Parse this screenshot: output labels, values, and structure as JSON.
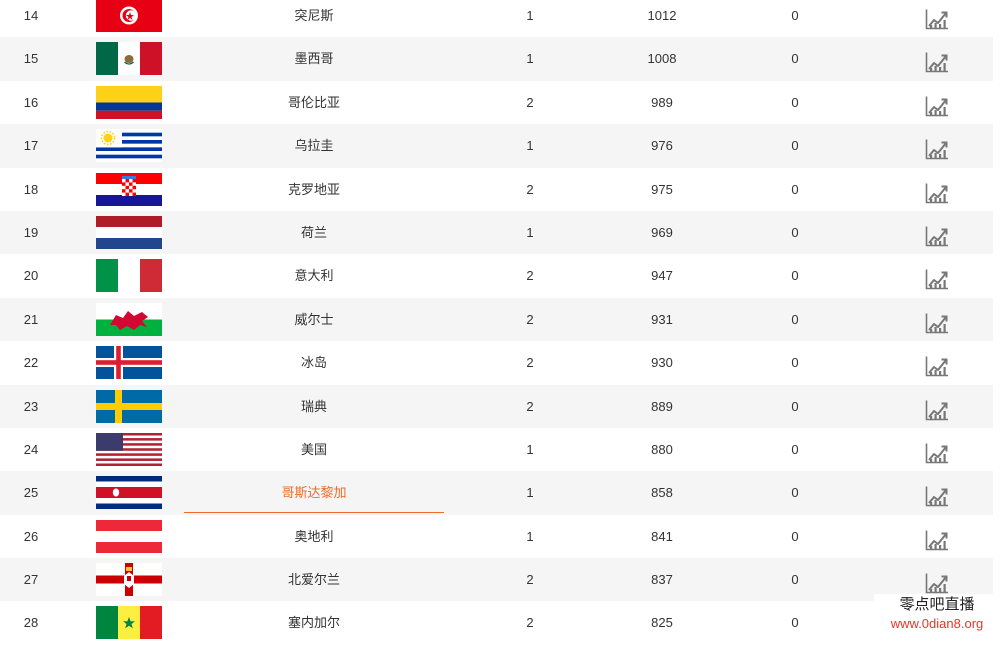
{
  "rows": [
    {
      "rank": "14",
      "country": "突尼斯",
      "played": "1",
      "points": "1012",
      "change": "0",
      "flag": "tunisia-flag"
    },
    {
      "rank": "15",
      "country": "墨西哥",
      "played": "1",
      "points": "1008",
      "change": "0",
      "flag": "mexico-flag"
    },
    {
      "rank": "16",
      "country": "哥伦比亚",
      "played": "2",
      "points": "989",
      "change": "0",
      "flag": "colombia-flag"
    },
    {
      "rank": "17",
      "country": "乌拉圭",
      "played": "1",
      "points": "976",
      "change": "0",
      "flag": "uruguay-flag"
    },
    {
      "rank": "18",
      "country": "克罗地亚",
      "played": "2",
      "points": "975",
      "change": "0",
      "flag": "croatia-flag"
    },
    {
      "rank": "19",
      "country": "荷兰",
      "played": "1",
      "points": "969",
      "change": "0",
      "flag": "netherlands-flag"
    },
    {
      "rank": "20",
      "country": "意大利",
      "played": "2",
      "points": "947",
      "change": "0",
      "flag": "italy-flag"
    },
    {
      "rank": "21",
      "country": "威尔士",
      "played": "2",
      "points": "931",
      "change": "0",
      "flag": "wales-flag"
    },
    {
      "rank": "22",
      "country": "冰岛",
      "played": "2",
      "points": "930",
      "change": "0",
      "flag": "iceland-flag"
    },
    {
      "rank": "23",
      "country": "瑞典",
      "played": "2",
      "points": "889",
      "change": "0",
      "flag": "sweden-flag"
    },
    {
      "rank": "24",
      "country": "美国",
      "played": "1",
      "points": "880",
      "change": "0",
      "flag": "usa-flag"
    },
    {
      "rank": "25",
      "country": "哥斯达黎加",
      "played": "1",
      "points": "858",
      "change": "0",
      "flag": "costa-rica-flag"
    },
    {
      "rank": "26",
      "country": "奥地利",
      "played": "1",
      "points": "841",
      "change": "0",
      "flag": "austria-flag"
    },
    {
      "rank": "27",
      "country": "北爱尔兰",
      "played": "2",
      "points": "837",
      "change": "0",
      "flag": "northern-ireland-flag"
    },
    {
      "rank": "28",
      "country": "塞内加尔",
      "played": "2",
      "points": "825",
      "change": "0",
      "flag": "senegal-flag"
    }
  ],
  "highlighted_row": 11,
  "trend_icon": "line-chart-icon",
  "colors": {
    "highlight": "#f06c27",
    "row_alt": "#f5f5f5",
    "watermark_url": "#e8352a"
  },
  "watermark": {
    "title": "零点吧直播",
    "url": "www.0dian8.org"
  }
}
